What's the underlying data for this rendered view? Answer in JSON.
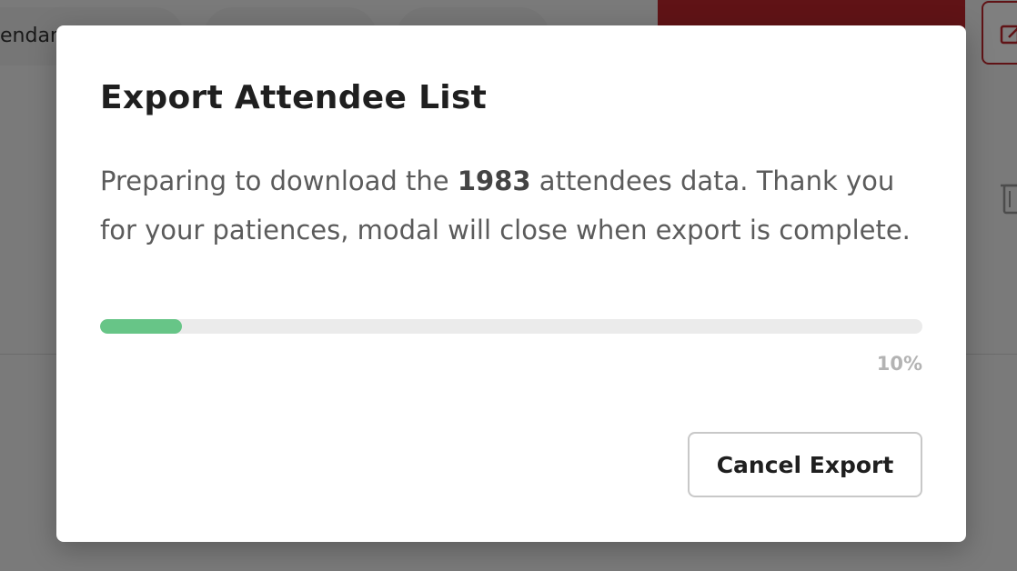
{
  "background": {
    "tabs": [
      "endar",
      "",
      ""
    ],
    "accent_color": "#c1272d"
  },
  "modal": {
    "title": "Export Attendee List",
    "message_before": "Preparing to download the ",
    "attendee_count": "1983",
    "message_after": " attendees data. Thank you for your patiences, modal will close when export is complete.",
    "progress": {
      "percent": 10,
      "label": "10%",
      "fill_color": "#67c587",
      "track_color": "#ebebeb"
    },
    "cancel_label": "Cancel Export"
  }
}
